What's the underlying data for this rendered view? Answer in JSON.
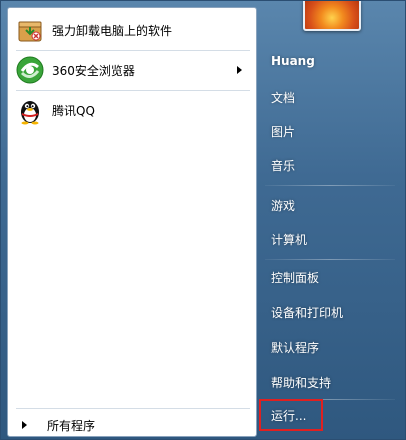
{
  "left_pane": {
    "pinned": [
      {
        "label": "强力卸载电脑上的软件",
        "icon": "uninstall-box-icon",
        "has_submenu": false
      },
      {
        "label": "360安全浏览器",
        "icon": "360-browser-icon",
        "has_submenu": true
      },
      {
        "label": "腾讯QQ",
        "icon": "qq-penguin-icon",
        "has_submenu": false
      }
    ],
    "all_programs_label": "所有程序"
  },
  "right_pane": {
    "user_name": "Huang",
    "items": [
      "文档",
      "图片",
      "音乐",
      "游戏",
      "计算机",
      "控制面板",
      "设备和打印机",
      "默认程序",
      "帮助和支持",
      "运行..."
    ]
  },
  "colors": {
    "menu_bg": "#3f6a93",
    "highlight_border": "#e02020",
    "browser_green": "#3aa53a"
  }
}
